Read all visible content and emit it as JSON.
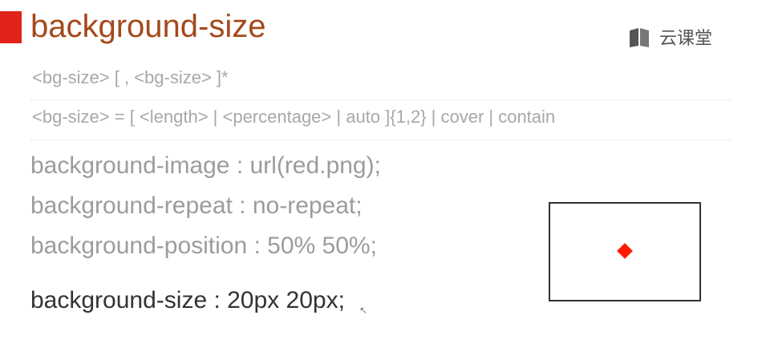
{
  "slide": {
    "title": "background-size",
    "brand": "云课堂",
    "syntax_line_1": "<bg-size> [ , <bg-size> ]*",
    "syntax_line_2": "<bg-size> = [ <length> | <percentage> | auto ]{1,2} | cover | contain",
    "code_lines": [
      "background-image : url(red.png);",
      "background-repeat : no-repeat;",
      "background-position : 50% 50%;"
    ],
    "highlight_line": "background-size : 20px 20px;",
    "colors": {
      "accent": "#e2231a",
      "title": "#a5491b",
      "demo_dot": "#ff1a00"
    }
  }
}
